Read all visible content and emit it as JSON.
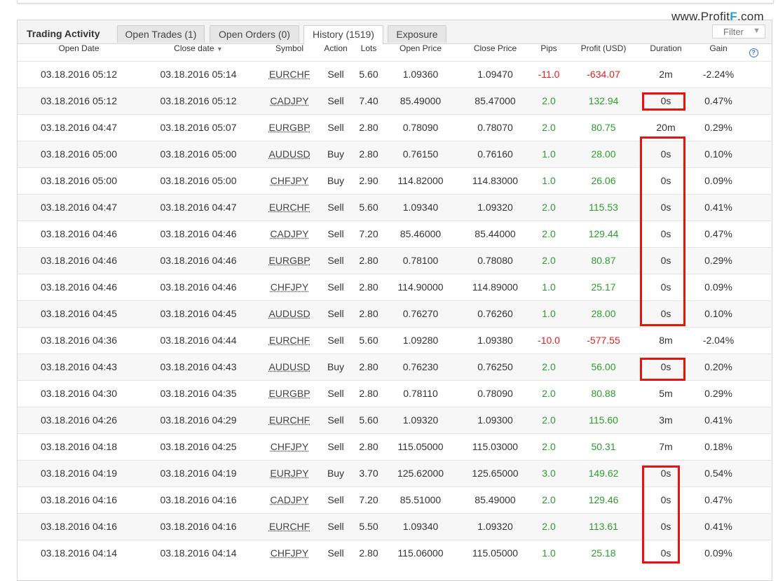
{
  "brand": {
    "prefix": "www.Profit",
    "mark": "F",
    "suffix": ".com"
  },
  "panel": {
    "title": "Trading Activity",
    "tabs": [
      "Open Trades (1)",
      "Open Orders (0)",
      "History (1519)",
      "Exposure"
    ],
    "active_tab": "History (1519)",
    "filter_label": "Filter",
    "filter_icon": "triangle-down-icon",
    "help_icon": "question-circle-icon"
  },
  "columns": [
    "Open Date",
    "Close date",
    "Symbol",
    "Action",
    "Lots",
    "Open Price",
    "Close Price",
    "Pips",
    "Profit (USD)",
    "Duration",
    "Gain"
  ],
  "sort_indicator": "▼",
  "rows": [
    {
      "open": "03.18.2016 05:12",
      "close": "03.18.2016 05:14",
      "symbol": "EURCHF",
      "action": "Sell",
      "lots": "5.60",
      "open_price": "1.09360",
      "close_price": "1.09470",
      "pips": "-11.0",
      "profit": "-634.07",
      "duration": "2m",
      "gain": "-2.24%"
    },
    {
      "open": "03.18.2016 05:12",
      "close": "03.18.2016 05:12",
      "symbol": "CADJPY",
      "action": "Sell",
      "lots": "7.40",
      "open_price": "85.49000",
      "close_price": "85.47000",
      "pips": "2.0",
      "profit": "132.94",
      "duration": "0s",
      "gain": "0.47%"
    },
    {
      "open": "03.18.2016 04:47",
      "close": "03.18.2016 05:07",
      "symbol": "EURGBP",
      "action": "Sell",
      "lots": "2.80",
      "open_price": "0.78090",
      "close_price": "0.78070",
      "pips": "2.0",
      "profit": "80.75",
      "duration": "20m",
      "gain": "0.29%"
    },
    {
      "open": "03.18.2016 05:00",
      "close": "03.18.2016 05:00",
      "symbol": "AUDUSD",
      "action": "Buy",
      "lots": "2.80",
      "open_price": "0.76150",
      "close_price": "0.76160",
      "pips": "1.0",
      "profit": "28.00",
      "duration": "0s",
      "gain": "0.10%"
    },
    {
      "open": "03.18.2016 05:00",
      "close": "03.18.2016 05:00",
      "symbol": "CHFJPY",
      "action": "Buy",
      "lots": "2.90",
      "open_price": "114.82000",
      "close_price": "114.83000",
      "pips": "1.0",
      "profit": "26.06",
      "duration": "0s",
      "gain": "0.09%"
    },
    {
      "open": "03.18.2016 04:47",
      "close": "03.18.2016 04:47",
      "symbol": "EURCHF",
      "action": "Sell",
      "lots": "5.60",
      "open_price": "1.09340",
      "close_price": "1.09320",
      "pips": "2.0",
      "profit": "115.53",
      "duration": "0s",
      "gain": "0.41%"
    },
    {
      "open": "03.18.2016 04:46",
      "close": "03.18.2016 04:46",
      "symbol": "CADJPY",
      "action": "Sell",
      "lots": "7.20",
      "open_price": "85.46000",
      "close_price": "85.44000",
      "pips": "2.0",
      "profit": "129.44",
      "duration": "0s",
      "gain": "0.47%"
    },
    {
      "open": "03.18.2016 04:46",
      "close": "03.18.2016 04:46",
      "symbol": "EURGBP",
      "action": "Sell",
      "lots": "2.80",
      "open_price": "0.78100",
      "close_price": "0.78080",
      "pips": "2.0",
      "profit": "80.87",
      "duration": "0s",
      "gain": "0.29%"
    },
    {
      "open": "03.18.2016 04:46",
      "close": "03.18.2016 04:46",
      "symbol": "CHFJPY",
      "action": "Sell",
      "lots": "2.80",
      "open_price": "114.90000",
      "close_price": "114.89000",
      "pips": "1.0",
      "profit": "25.17",
      "duration": "0s",
      "gain": "0.09%"
    },
    {
      "open": "03.18.2016 04:45",
      "close": "03.18.2016 04:45",
      "symbol": "AUDUSD",
      "action": "Sell",
      "lots": "2.80",
      "open_price": "0.76270",
      "close_price": "0.76260",
      "pips": "1.0",
      "profit": "28.00",
      "duration": "0s",
      "gain": "0.10%"
    },
    {
      "open": "03.18.2016 04:36",
      "close": "03.18.2016 04:44",
      "symbol": "EURCHF",
      "action": "Sell",
      "lots": "5.60",
      "open_price": "1.09280",
      "close_price": "1.09380",
      "pips": "-10.0",
      "profit": "-577.55",
      "duration": "8m",
      "gain": "-2.04%"
    },
    {
      "open": "03.18.2016 04:43",
      "close": "03.18.2016 04:43",
      "symbol": "AUDUSD",
      "action": "Buy",
      "lots": "2.80",
      "open_price": "0.76230",
      "close_price": "0.76250",
      "pips": "2.0",
      "profit": "56.00",
      "duration": "0s",
      "gain": "0.20%"
    },
    {
      "open": "03.18.2016 04:30",
      "close": "03.18.2016 04:35",
      "symbol": "EURGBP",
      "action": "Sell",
      "lots": "2.80",
      "open_price": "0.78110",
      "close_price": "0.78090",
      "pips": "2.0",
      "profit": "80.88",
      "duration": "5m",
      "gain": "0.29%"
    },
    {
      "open": "03.18.2016 04:26",
      "close": "03.18.2016 04:29",
      "symbol": "EURCHF",
      "action": "Sell",
      "lots": "5.60",
      "open_price": "1.09320",
      "close_price": "1.09300",
      "pips": "2.0",
      "profit": "115.60",
      "duration": "3m",
      "gain": "0.41%"
    },
    {
      "open": "03.18.2016 04:18",
      "close": "03.18.2016 04:25",
      "symbol": "CHFJPY",
      "action": "Sell",
      "lots": "2.80",
      "open_price": "115.05000",
      "close_price": "115.03000",
      "pips": "2.0",
      "profit": "50.31",
      "duration": "7m",
      "gain": "0.18%"
    },
    {
      "open": "03.18.2016 04:19",
      "close": "03.18.2016 04:19",
      "symbol": "EURJPY",
      "action": "Buy",
      "lots": "3.70",
      "open_price": "125.62000",
      "close_price": "125.65000",
      "pips": "3.0",
      "profit": "149.62",
      "duration": "0s",
      "gain": "0.54%"
    },
    {
      "open": "03.18.2016 04:16",
      "close": "03.18.2016 04:16",
      "symbol": "CADJPY",
      "action": "Sell",
      "lots": "7.20",
      "open_price": "85.51000",
      "close_price": "85.49000",
      "pips": "2.0",
      "profit": "129.46",
      "duration": "0s",
      "gain": "0.47%"
    },
    {
      "open": "03.18.2016 04:16",
      "close": "03.18.2016 04:16",
      "symbol": "EURCHF",
      "action": "Sell",
      "lots": "5.50",
      "open_price": "1.09340",
      "close_price": "1.09320",
      "pips": "2.0",
      "profit": "113.61",
      "duration": "0s",
      "gain": "0.41%"
    },
    {
      "open": "03.18.2016 04:14",
      "close": "03.18.2016 04:14",
      "symbol": "CHFJPY",
      "action": "Sell",
      "lots": "2.80",
      "open_price": "115.06000",
      "close_price": "115.05000",
      "pips": "1.0",
      "profit": "25.18",
      "duration": "0s",
      "gain": "0.09%"
    }
  ],
  "colors": {
    "positive": "#2e9b2e",
    "negative": "#e62020",
    "highlight": "#ee1010",
    "brand_mark": "#2a9fd6"
  }
}
